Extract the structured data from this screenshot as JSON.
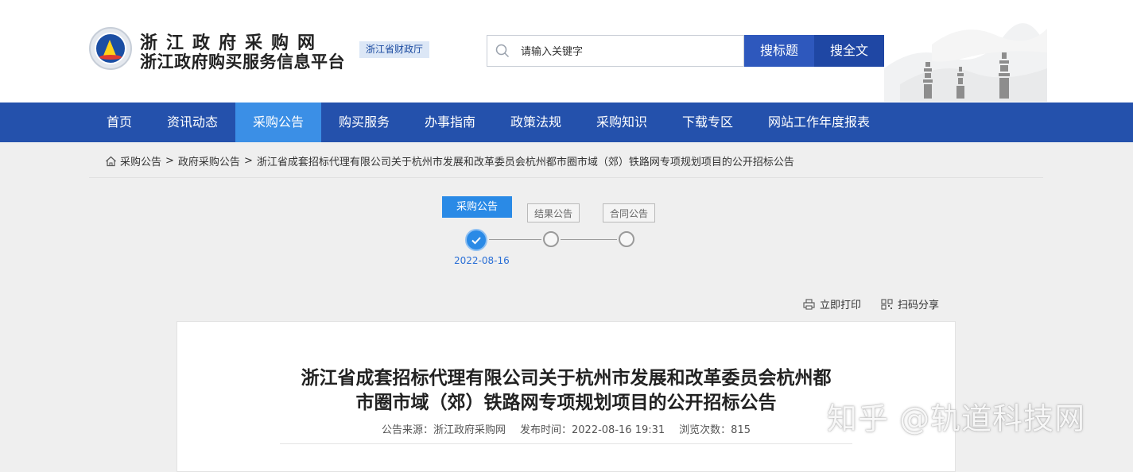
{
  "header": {
    "site_title_1": "浙江政府采购网",
    "site_title_2": "浙江政府购买服务信息平台",
    "dept_badge": "浙江省财政厅",
    "search": {
      "placeholder": "请输入关键字",
      "button_title": "搜标题",
      "button_full": "搜全文"
    }
  },
  "nav": {
    "items": [
      "首页",
      "资讯动态",
      "采购公告",
      "购买服务",
      "办事指南",
      "政策法规",
      "采购知识",
      "下载专区",
      "网站工作年度报表"
    ],
    "active": "采购公告"
  },
  "breadcrumb": {
    "items": [
      "采购公告",
      "政府采购公告",
      "浙江省成套招标代理有限公司关于杭州市发展和改革委员会杭州都市圈市域（郊）铁路网专项规划项目的公开招标公告"
    ],
    "separator": ">"
  },
  "progress": {
    "steps": [
      "采购公告",
      "结果公告",
      "合同公告"
    ],
    "current_date": "2022-08-16"
  },
  "tools": {
    "print": "立即打印",
    "share": "扫码分享"
  },
  "article": {
    "title_line_1": "浙江省成套招标代理有限公司关于杭州市发展和改革委员会杭州都",
    "title_line_2": "市圈市域（郊）铁路网专项规划项目的公开招标公告",
    "source_label": "公告来源：浙江政府采购网",
    "publish_label": "发布时间：2022-08-16 19:31",
    "views_label": "浏览次数：815"
  },
  "watermark": "知乎 @轨道科技网",
  "colors": {
    "nav_bg": "#2451ac",
    "nav_active": "#3b8fe6",
    "search_btn": "#2e58bd",
    "step_active": "#2a8ae6"
  }
}
